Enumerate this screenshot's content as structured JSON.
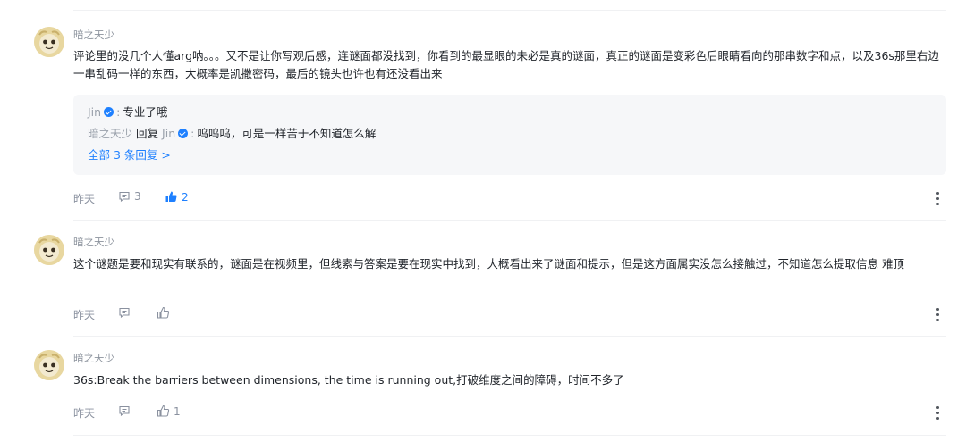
{
  "comments": [
    {
      "author": "暗之天少",
      "text": "评论里的没几个人懂arg呐。。。又不是让你写观后感，连谜面都没找到，你看到的最显眼的未必是真的谜面，真正的谜面是变彩色后眼睛看向的那串数字和点，以及36s那里右边一串乱码一样的东西，大概率是凯撒密码，最后的镜头也许也有还没看出来",
      "time": "昨天",
      "reply_count": "3",
      "like_count": "2",
      "replies": [
        {
          "name": "Jin",
          "content": "专业了哦"
        },
        {
          "name": "暗之天少",
          "reply_word": "回复",
          "target": "Jin",
          "content": "呜呜呜，可是一样苦于不知道怎么解"
        }
      ],
      "all_replies_label": "全部 3 条回复 >"
    },
    {
      "author": "暗之天少",
      "text": "这个谜题是要和现实有联系的，谜面是在视频里，但线索与答案是要在现实中找到，大概看出来了谜面和提示，但是这方面属实没怎么接触过，不知道怎么提取信息 难顶",
      "time": "昨天",
      "reply_count": "",
      "like_count": ""
    },
    {
      "author": "暗之天少",
      "text": "36s:Break the barriers between dimensions, the time is running out,打破维度之间的障碍，时间不多了",
      "time": "昨天",
      "reply_count": "",
      "like_count": "1"
    }
  ],
  "colors": {
    "accent": "#1e80ff",
    "muted": "#8a919f",
    "reply_bg": "#f6f7f9"
  },
  "icons": [
    "avatar",
    "verified-badge-icon",
    "comment-icon",
    "like-icon",
    "more-icon"
  ]
}
